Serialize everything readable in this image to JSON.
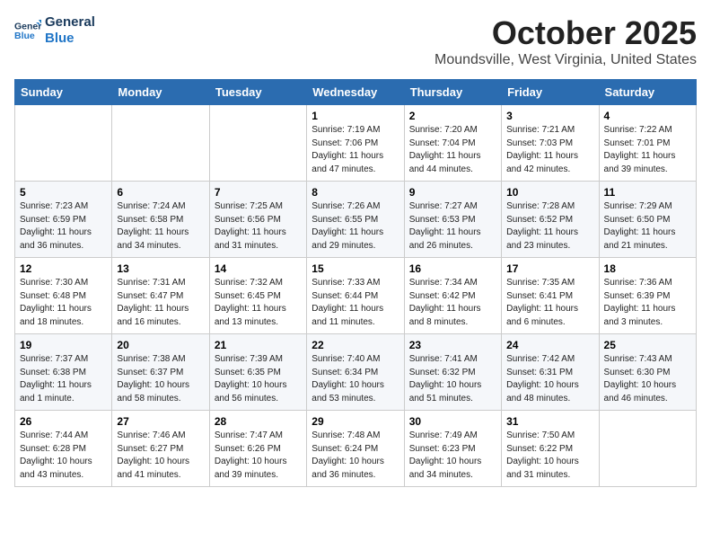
{
  "header": {
    "logo_line1": "General",
    "logo_line2": "Blue",
    "month": "October 2025",
    "location": "Moundsville, West Virginia, United States"
  },
  "days_of_week": [
    "Sunday",
    "Monday",
    "Tuesday",
    "Wednesday",
    "Thursday",
    "Friday",
    "Saturday"
  ],
  "weeks": [
    [
      {
        "day": "",
        "info": ""
      },
      {
        "day": "",
        "info": ""
      },
      {
        "day": "",
        "info": ""
      },
      {
        "day": "1",
        "info": "Sunrise: 7:19 AM\nSunset: 7:06 PM\nDaylight: 11 hours and 47 minutes."
      },
      {
        "day": "2",
        "info": "Sunrise: 7:20 AM\nSunset: 7:04 PM\nDaylight: 11 hours and 44 minutes."
      },
      {
        "day": "3",
        "info": "Sunrise: 7:21 AM\nSunset: 7:03 PM\nDaylight: 11 hours and 42 minutes."
      },
      {
        "day": "4",
        "info": "Sunrise: 7:22 AM\nSunset: 7:01 PM\nDaylight: 11 hours and 39 minutes."
      }
    ],
    [
      {
        "day": "5",
        "info": "Sunrise: 7:23 AM\nSunset: 6:59 PM\nDaylight: 11 hours and 36 minutes."
      },
      {
        "day": "6",
        "info": "Sunrise: 7:24 AM\nSunset: 6:58 PM\nDaylight: 11 hours and 34 minutes."
      },
      {
        "day": "7",
        "info": "Sunrise: 7:25 AM\nSunset: 6:56 PM\nDaylight: 11 hours and 31 minutes."
      },
      {
        "day": "8",
        "info": "Sunrise: 7:26 AM\nSunset: 6:55 PM\nDaylight: 11 hours and 29 minutes."
      },
      {
        "day": "9",
        "info": "Sunrise: 7:27 AM\nSunset: 6:53 PM\nDaylight: 11 hours and 26 minutes."
      },
      {
        "day": "10",
        "info": "Sunrise: 7:28 AM\nSunset: 6:52 PM\nDaylight: 11 hours and 23 minutes."
      },
      {
        "day": "11",
        "info": "Sunrise: 7:29 AM\nSunset: 6:50 PM\nDaylight: 11 hours and 21 minutes."
      }
    ],
    [
      {
        "day": "12",
        "info": "Sunrise: 7:30 AM\nSunset: 6:48 PM\nDaylight: 11 hours and 18 minutes."
      },
      {
        "day": "13",
        "info": "Sunrise: 7:31 AM\nSunset: 6:47 PM\nDaylight: 11 hours and 16 minutes."
      },
      {
        "day": "14",
        "info": "Sunrise: 7:32 AM\nSunset: 6:45 PM\nDaylight: 11 hours and 13 minutes."
      },
      {
        "day": "15",
        "info": "Sunrise: 7:33 AM\nSunset: 6:44 PM\nDaylight: 11 hours and 11 minutes."
      },
      {
        "day": "16",
        "info": "Sunrise: 7:34 AM\nSunset: 6:42 PM\nDaylight: 11 hours and 8 minutes."
      },
      {
        "day": "17",
        "info": "Sunrise: 7:35 AM\nSunset: 6:41 PM\nDaylight: 11 hours and 6 minutes."
      },
      {
        "day": "18",
        "info": "Sunrise: 7:36 AM\nSunset: 6:39 PM\nDaylight: 11 hours and 3 minutes."
      }
    ],
    [
      {
        "day": "19",
        "info": "Sunrise: 7:37 AM\nSunset: 6:38 PM\nDaylight: 11 hours and 1 minute."
      },
      {
        "day": "20",
        "info": "Sunrise: 7:38 AM\nSunset: 6:37 PM\nDaylight: 10 hours and 58 minutes."
      },
      {
        "day": "21",
        "info": "Sunrise: 7:39 AM\nSunset: 6:35 PM\nDaylight: 10 hours and 56 minutes."
      },
      {
        "day": "22",
        "info": "Sunrise: 7:40 AM\nSunset: 6:34 PM\nDaylight: 10 hours and 53 minutes."
      },
      {
        "day": "23",
        "info": "Sunrise: 7:41 AM\nSunset: 6:32 PM\nDaylight: 10 hours and 51 minutes."
      },
      {
        "day": "24",
        "info": "Sunrise: 7:42 AM\nSunset: 6:31 PM\nDaylight: 10 hours and 48 minutes."
      },
      {
        "day": "25",
        "info": "Sunrise: 7:43 AM\nSunset: 6:30 PM\nDaylight: 10 hours and 46 minutes."
      }
    ],
    [
      {
        "day": "26",
        "info": "Sunrise: 7:44 AM\nSunset: 6:28 PM\nDaylight: 10 hours and 43 minutes."
      },
      {
        "day": "27",
        "info": "Sunrise: 7:46 AM\nSunset: 6:27 PM\nDaylight: 10 hours and 41 minutes."
      },
      {
        "day": "28",
        "info": "Sunrise: 7:47 AM\nSunset: 6:26 PM\nDaylight: 10 hours and 39 minutes."
      },
      {
        "day": "29",
        "info": "Sunrise: 7:48 AM\nSunset: 6:24 PM\nDaylight: 10 hours and 36 minutes."
      },
      {
        "day": "30",
        "info": "Sunrise: 7:49 AM\nSunset: 6:23 PM\nDaylight: 10 hours and 34 minutes."
      },
      {
        "day": "31",
        "info": "Sunrise: 7:50 AM\nSunset: 6:22 PM\nDaylight: 10 hours and 31 minutes."
      },
      {
        "day": "",
        "info": ""
      }
    ]
  ]
}
